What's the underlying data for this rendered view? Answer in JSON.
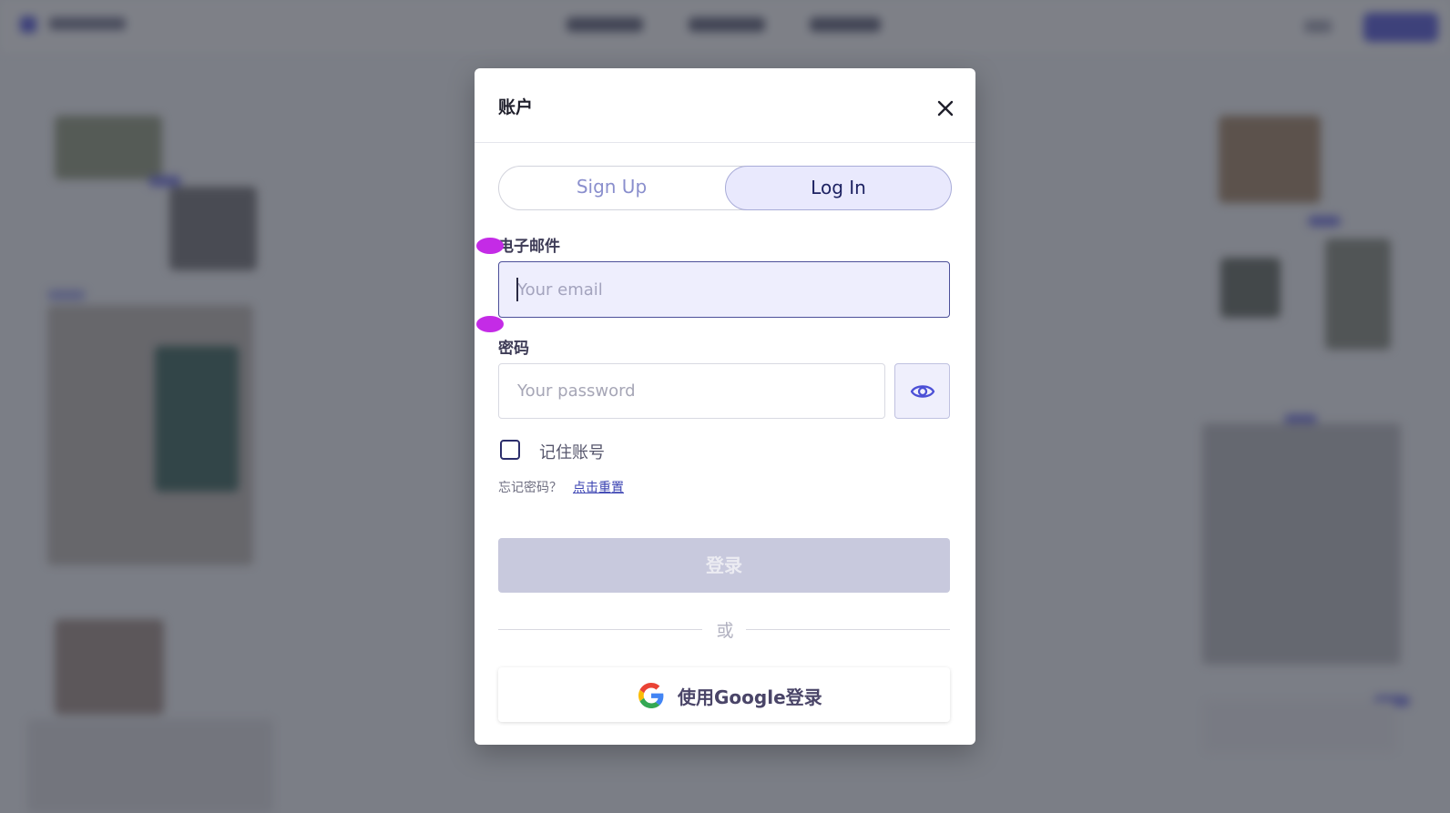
{
  "modal": {
    "title": "账户",
    "tabs": {
      "signup": "Sign Up",
      "login": "Log In",
      "active": "login"
    },
    "email": {
      "label": "电子邮件",
      "placeholder": "Your email",
      "value": ""
    },
    "password": {
      "label": "密码",
      "placeholder": "Your password",
      "value": ""
    },
    "remember": {
      "label": "记住账号",
      "checked": false
    },
    "forgot": {
      "text": "忘记密码？",
      "link": "点击重置"
    },
    "submit_label": "登录",
    "divider_text": "或",
    "google_label": "使用Google登录"
  },
  "icons": {
    "close": "close-icon",
    "eye": "eye-icon",
    "google": "google-icon"
  },
  "colors": {
    "accent": "#4b4fd6",
    "tab_active_bg": "#e9e9fd",
    "input_focus_bg": "#eeeefd",
    "disabled_button": "#c8c9dd",
    "marker": "#c42be6"
  }
}
